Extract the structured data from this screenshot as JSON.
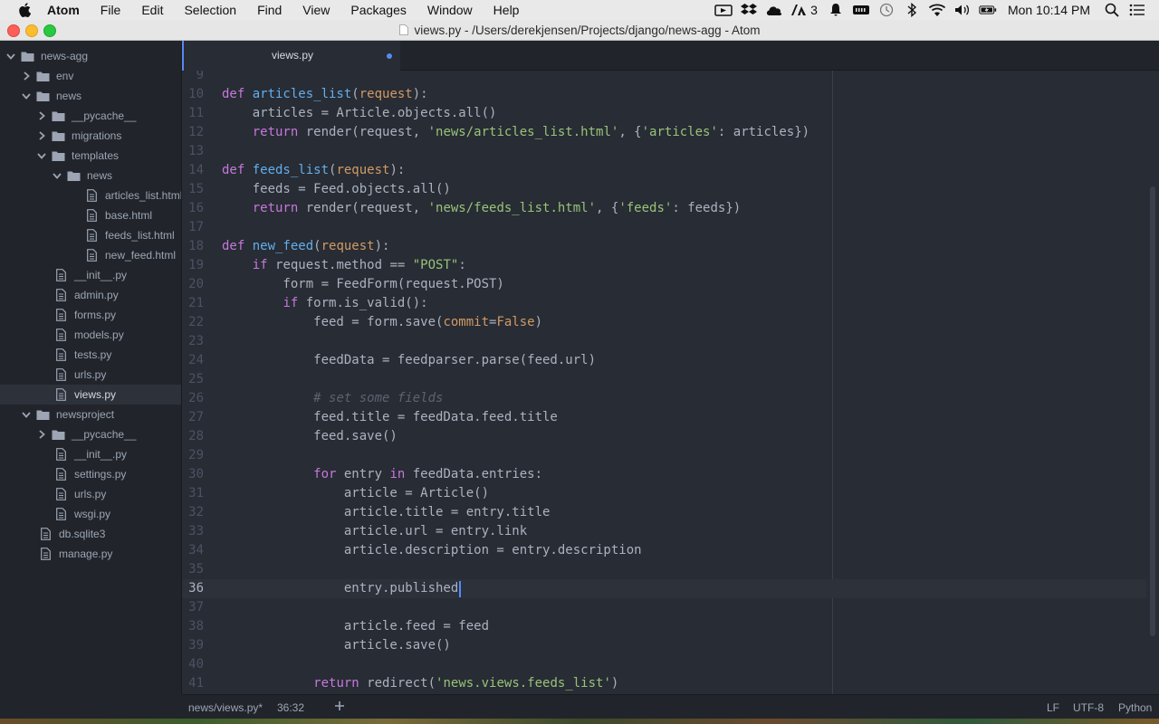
{
  "menubar": {
    "app_name": "Atom",
    "items": [
      "File",
      "Edit",
      "Selection",
      "Find",
      "View",
      "Packages",
      "Window",
      "Help"
    ],
    "adobe_count": "3",
    "clock": "Mon 10:14 PM"
  },
  "window": {
    "title": "views.py - /Users/derekjensen/Projects/django/news-agg - Atom"
  },
  "sidebar": {
    "items": [
      {
        "label": "news-agg",
        "type": "folder",
        "expanded": true,
        "depth": 0
      },
      {
        "label": "env",
        "type": "folder",
        "expanded": false,
        "depth": 1
      },
      {
        "label": "news",
        "type": "folder",
        "expanded": true,
        "depth": 1
      },
      {
        "label": "__pycache__",
        "type": "folder",
        "expanded": false,
        "depth": 2
      },
      {
        "label": "migrations",
        "type": "folder",
        "expanded": false,
        "depth": 2
      },
      {
        "label": "templates",
        "type": "folder",
        "expanded": true,
        "depth": 2
      },
      {
        "label": "news",
        "type": "folder",
        "expanded": true,
        "depth": 3
      },
      {
        "label": "articles_list.html",
        "type": "file",
        "depth": 4
      },
      {
        "label": "base.html",
        "type": "file",
        "depth": 4
      },
      {
        "label": "feeds_list.html",
        "type": "file",
        "depth": 4
      },
      {
        "label": "new_feed.html",
        "type": "file",
        "depth": 4
      },
      {
        "label": "__init__.py",
        "type": "file",
        "depth": 2
      },
      {
        "label": "admin.py",
        "type": "file",
        "depth": 2
      },
      {
        "label": "forms.py",
        "type": "file",
        "depth": 2
      },
      {
        "label": "models.py",
        "type": "file",
        "depth": 2
      },
      {
        "label": "tests.py",
        "type": "file",
        "depth": 2
      },
      {
        "label": "urls.py",
        "type": "file",
        "depth": 2
      },
      {
        "label": "views.py",
        "type": "file",
        "depth": 2,
        "selected": true
      },
      {
        "label": "newsproject",
        "type": "folder",
        "expanded": true,
        "depth": 1
      },
      {
        "label": "__pycache__",
        "type": "folder",
        "expanded": false,
        "depth": 2
      },
      {
        "label": "__init__.py",
        "type": "file",
        "depth": 2
      },
      {
        "label": "settings.py",
        "type": "file",
        "depth": 2
      },
      {
        "label": "urls.py",
        "type": "file",
        "depth": 2
      },
      {
        "label": "wsgi.py",
        "type": "file",
        "depth": 2
      },
      {
        "label": "db.sqlite3",
        "type": "file",
        "depth": 1
      },
      {
        "label": "manage.py",
        "type": "file",
        "depth": 1
      }
    ]
  },
  "tabs": [
    {
      "label": "views.py",
      "modified": true,
      "active": true
    }
  ],
  "editor": {
    "cursor_line": 36,
    "lines": [
      {
        "n": "9",
        "t": []
      },
      {
        "n": "10",
        "t": [
          [
            "kw",
            "def "
          ],
          [
            "fn",
            "articles_list"
          ],
          [
            "pl",
            "("
          ],
          [
            "param",
            "request"
          ],
          [
            "pl",
            "):"
          ]
        ]
      },
      {
        "n": "11",
        "t": [
          [
            "pl",
            "    articles = Article.objects.all()"
          ]
        ]
      },
      {
        "n": "12",
        "t": [
          [
            "pl",
            "    "
          ],
          [
            "kw",
            "return "
          ],
          [
            "pl",
            "render(request, "
          ],
          [
            "str",
            "'news/articles_list.html'"
          ],
          [
            "pl",
            ", {"
          ],
          [
            "str",
            "'articles'"
          ],
          [
            "pl",
            ": articles})"
          ]
        ]
      },
      {
        "n": "13",
        "t": []
      },
      {
        "n": "14",
        "t": [
          [
            "kw",
            "def "
          ],
          [
            "fn",
            "feeds_list"
          ],
          [
            "pl",
            "("
          ],
          [
            "param",
            "request"
          ],
          [
            "pl",
            "):"
          ]
        ]
      },
      {
        "n": "15",
        "t": [
          [
            "pl",
            "    feeds = Feed.objects.all()"
          ]
        ]
      },
      {
        "n": "16",
        "t": [
          [
            "pl",
            "    "
          ],
          [
            "kw",
            "return "
          ],
          [
            "pl",
            "render(request, "
          ],
          [
            "str",
            "'news/feeds_list.html'"
          ],
          [
            "pl",
            ", {"
          ],
          [
            "str",
            "'feeds'"
          ],
          [
            "pl",
            ": feeds})"
          ]
        ]
      },
      {
        "n": "17",
        "t": []
      },
      {
        "n": "18",
        "t": [
          [
            "kw",
            "def "
          ],
          [
            "fn",
            "new_feed"
          ],
          [
            "pl",
            "("
          ],
          [
            "param",
            "request"
          ],
          [
            "pl",
            "):"
          ]
        ]
      },
      {
        "n": "19",
        "t": [
          [
            "pl",
            "    "
          ],
          [
            "kw",
            "if "
          ],
          [
            "pl",
            "request.method == "
          ],
          [
            "str",
            "\"POST\""
          ],
          [
            "pl",
            ":"
          ]
        ]
      },
      {
        "n": "20",
        "t": [
          [
            "pl",
            "        form = FeedForm(request.POST)"
          ]
        ]
      },
      {
        "n": "21",
        "t": [
          [
            "pl",
            "        "
          ],
          [
            "kw",
            "if "
          ],
          [
            "pl",
            "form.is_valid():"
          ]
        ]
      },
      {
        "n": "22",
        "t": [
          [
            "pl",
            "            feed = form.save("
          ],
          [
            "param",
            "commit"
          ],
          [
            "pl",
            "="
          ],
          [
            "num",
            "False"
          ],
          [
            "pl",
            ")"
          ]
        ]
      },
      {
        "n": "23",
        "t": []
      },
      {
        "n": "24",
        "t": [
          [
            "pl",
            "            feedData = feedparser.parse(feed.url)"
          ]
        ]
      },
      {
        "n": "25",
        "t": []
      },
      {
        "n": "26",
        "t": [
          [
            "pl",
            "            "
          ],
          [
            "cmt",
            "# set some fields"
          ]
        ]
      },
      {
        "n": "27",
        "t": [
          [
            "pl",
            "            feed.title = feedData.feed.title"
          ]
        ]
      },
      {
        "n": "28",
        "t": [
          [
            "pl",
            "            feed.save()"
          ]
        ]
      },
      {
        "n": "29",
        "t": []
      },
      {
        "n": "30",
        "t": [
          [
            "pl",
            "            "
          ],
          [
            "kw",
            "for "
          ],
          [
            "pl",
            "entry "
          ],
          [
            "kw",
            "in "
          ],
          [
            "pl",
            "feedData.entries:"
          ]
        ]
      },
      {
        "n": "31",
        "t": [
          [
            "pl",
            "                article = Article()"
          ]
        ]
      },
      {
        "n": "32",
        "t": [
          [
            "pl",
            "                article.title = entry.title"
          ]
        ]
      },
      {
        "n": "33",
        "t": [
          [
            "pl",
            "                article.url = entry.link"
          ]
        ]
      },
      {
        "n": "34",
        "t": [
          [
            "pl",
            "                article.description = entry.description"
          ]
        ]
      },
      {
        "n": "35",
        "t": []
      },
      {
        "n": "36",
        "t": [
          [
            "pl",
            "                entry.published"
          ]
        ]
      },
      {
        "n": "37",
        "t": []
      },
      {
        "n": "38",
        "t": [
          [
            "pl",
            "                article.feed = feed"
          ]
        ]
      },
      {
        "n": "39",
        "t": [
          [
            "pl",
            "                article.save()"
          ]
        ]
      },
      {
        "n": "40",
        "t": []
      },
      {
        "n": "41",
        "t": [
          [
            "pl",
            "            "
          ],
          [
            "kw",
            "return "
          ],
          [
            "pl",
            "redirect("
          ],
          [
            "str",
            "'news.views.feeds_list'"
          ],
          [
            "pl",
            ")"
          ]
        ]
      }
    ]
  },
  "statusbar": {
    "file_path": "news/views.py*",
    "cursor_position": "36:32",
    "line_ending": "LF",
    "encoding": "UTF-8",
    "grammar": "Python"
  },
  "colors": {
    "accent": "#568af2",
    "editor_bg": "#282c34",
    "sidebar_bg": "#21252b"
  }
}
